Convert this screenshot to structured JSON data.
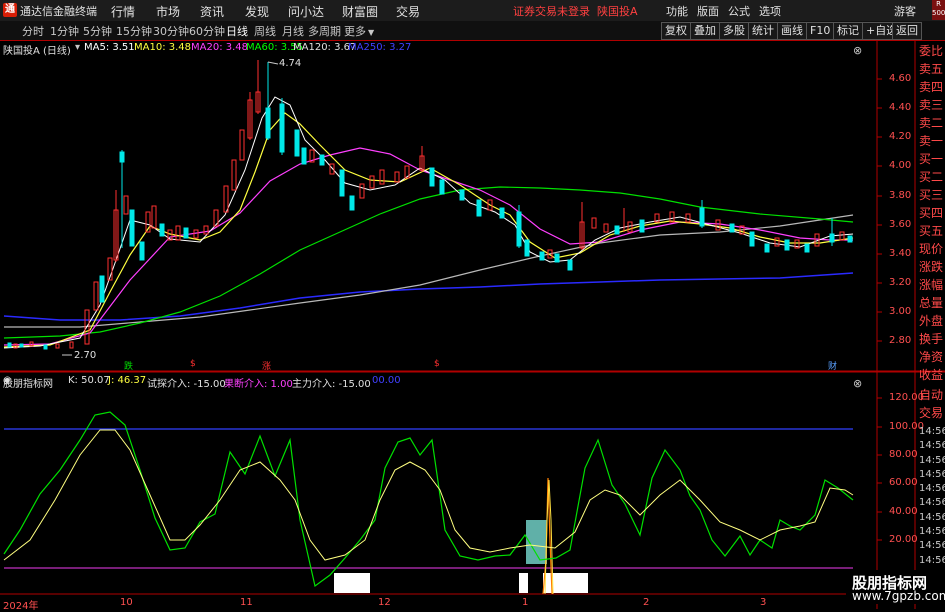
{
  "menubar": {
    "app_title": "通达信金融终端",
    "items": [
      "行情",
      "市场",
      "资讯",
      "发现",
      "问小达",
      "财富圈",
      "交易"
    ],
    "alert": "证券交易未登录",
    "stock": "陕国投A",
    "right": [
      "功能",
      "版面",
      "公式",
      "选项",
      "游客"
    ],
    "r500": [
      "R",
      "500"
    ]
  },
  "toolbar": {
    "periods": [
      "分时",
      "1分钟",
      "5分钟",
      "15分钟",
      "30分钟",
      "60分钟",
      "日线",
      "周线",
      "月线",
      "多周期",
      "更多"
    ],
    "active": "日线",
    "buttons": [
      "复权",
      "叠加",
      "多股",
      "统计",
      "画线",
      "F10",
      "标记",
      "+自选",
      "返回"
    ]
  },
  "main_legend": {
    "title": "陕国投A (日线)",
    "ma5": "MA5: 3.51",
    "ma10": "MA10: 3.48",
    "ma20": "MA20: 3.48",
    "ma60": "MA60: 3.55",
    "ma120": "MA120: 3.67",
    "ma250": "MA250: 3.27"
  },
  "price_axis": [
    "4.60",
    "4.40",
    "4.20",
    "4.00",
    "3.80",
    "3.60",
    "3.40",
    "3.20",
    "3.00",
    "2.80"
  ],
  "annotations": {
    "high": "4.74",
    "low": "2.70"
  },
  "signals": [
    {
      "text": "跌",
      "color": "#00e000"
    },
    {
      "text": "$",
      "color": "#ff3030"
    },
    {
      "text": "涨",
      "color": "#ff3030"
    },
    {
      "text": "$",
      "color": "#ff3030"
    },
    {
      "text": "财",
      "color": "#5aa0ff"
    }
  ],
  "indicator_legend": {
    "name": "股朋指标网",
    "k": "K: 50.07",
    "j": "J: 46.37",
    "test": "试探介入: -15.00",
    "decisive": "果断介入: 1.00",
    "main": "主力介入: -15.00",
    "blue": "00.00"
  },
  "indicator_axis": [
    "120.00",
    "100.00",
    "80.00",
    "60.00",
    "40.00",
    "20.00"
  ],
  "x_axis": [
    "2024年",
    "10",
    "11",
    "12",
    "1",
    "2",
    "3"
  ],
  "right_panel": [
    "委比",
    "卖五",
    "卖四",
    "卖三",
    "卖二",
    "卖一",
    "买一",
    "买二",
    "买三",
    "买四",
    "买五",
    "现价",
    "涨跌",
    "涨幅",
    "总量",
    "外盘",
    "换手",
    "净资",
    "收益"
  ],
  "right_panel2": [
    "自动",
    "交易"
  ],
  "time_col": [
    "14:56",
    "14:56",
    "14:56",
    "14:56",
    "14:56",
    "14:56",
    "14:56",
    "14:56",
    "14:56",
    "14:56"
  ],
  "watermark": {
    "line1": "股朋指标网",
    "line2": "www.7gpzb.com"
  },
  "colors": {
    "up": "#ff3030",
    "down": "#00e8e8",
    "ma5": "#ffffff",
    "ma10": "#ffff00",
    "ma20": "#ff40ff",
    "ma60": "#00ff00",
    "ma120": "#c0c0c0",
    "ma250": "#3030ff"
  }
}
